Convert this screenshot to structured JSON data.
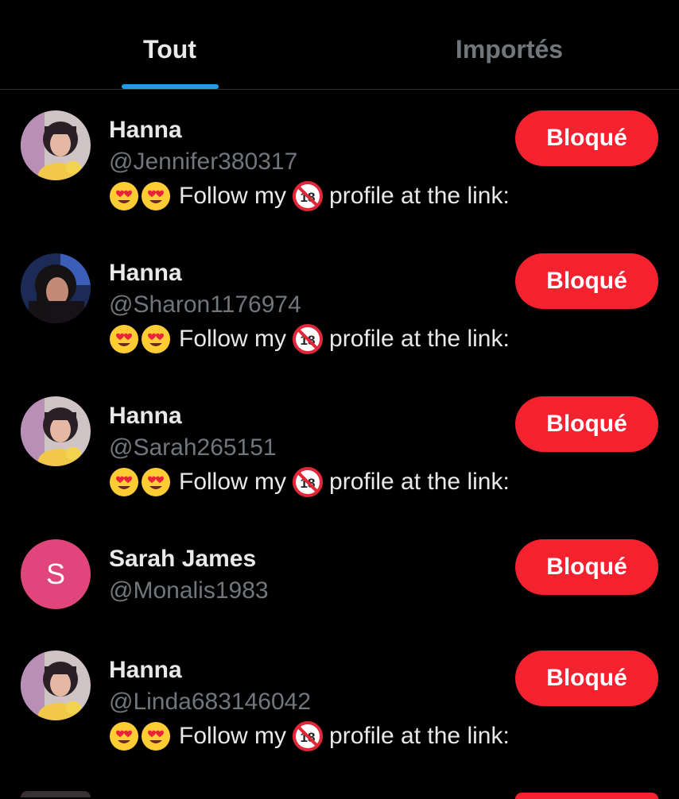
{
  "tabs": [
    {
      "label": "Tout",
      "active": true
    },
    {
      "label": "Importés",
      "active": false
    }
  ],
  "accent_color": "#1d9bf0",
  "block_color": "#f4212e",
  "accounts": [
    {
      "name": "Hanna",
      "handle": "@Jennifer380317",
      "bio_before": "Follow my",
      "bio_after": "profile at the link:",
      "button": "Bloqué",
      "avatar": "photo-pink-hair"
    },
    {
      "name": "Hanna",
      "handle": "@Sharon1176974",
      "bio_before": "Follow my",
      "bio_after": "profile at the link:",
      "button": "Bloqué",
      "avatar": "photo-dark-hair"
    },
    {
      "name": "Hanna",
      "handle": "@Sarah265151",
      "bio_before": "Follow my",
      "bio_after": "profile at the link:",
      "button": "Bloqué",
      "avatar": "photo-pink-hair"
    },
    {
      "name": "Sarah James",
      "handle": "@Monalis1983",
      "button": "Bloqué",
      "avatar_letter": "S"
    },
    {
      "name": "Hanna",
      "handle": "@Linda683146042",
      "bio_before": "Follow my",
      "bio_after": "profile at the link:",
      "button": "Bloqué",
      "avatar": "photo-pink-hair"
    }
  ]
}
